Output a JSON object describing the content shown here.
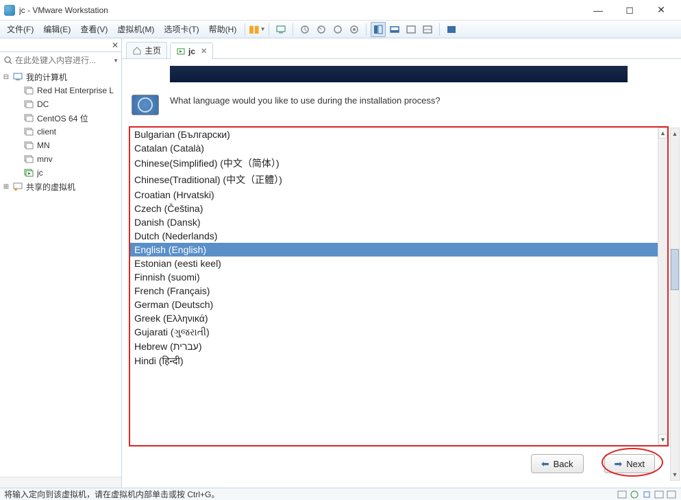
{
  "window": {
    "title": "jc - VMware Workstation"
  },
  "menu": {
    "file": "文件(F)",
    "edit": "编辑(E)",
    "view": "查看(V)",
    "vm": "虚拟机(M)",
    "tabs": "选项卡(T)",
    "help": "帮助(H)"
  },
  "sidebar": {
    "search_placeholder": "在此处键入内容进行...",
    "root": "我的计算机",
    "items": [
      "Red Hat Enterprise L",
      "DC",
      "CentOS 64 位",
      "client",
      "MN",
      "mnv",
      "jc"
    ],
    "shared": "共享的虚拟机"
  },
  "tabs": {
    "home": "主页",
    "jc": "jc"
  },
  "installer": {
    "prompt": "What language would you like to use during the installation process?",
    "languages": [
      "Bulgarian (Български)",
      "Catalan (Català)",
      "Chinese(Simplified) (中文（简体）)",
      "Chinese(Traditional) (中文（正體）)",
      "Croatian (Hrvatski)",
      "Czech (Čeština)",
      "Danish (Dansk)",
      "Dutch (Nederlands)",
      "English (English)",
      "Estonian (eesti keel)",
      "Finnish (suomi)",
      "French (Français)",
      "German (Deutsch)",
      "Greek (Ελληνικά)",
      "Gujarati (ગુજરાતી)",
      "Hebrew (עברית)",
      "Hindi (हिन्दी)"
    ],
    "selected_index": 8,
    "back": "Back",
    "next": "Next"
  },
  "status": {
    "hint": "将输入定向到该虚拟机，请在虚拟机内部单击或按 Ctrl+G。"
  }
}
